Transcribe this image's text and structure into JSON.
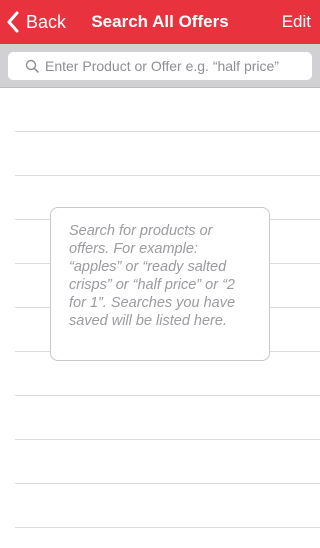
{
  "navbar": {
    "back_label": "Back",
    "title": "Search All Offers",
    "edit_label": "Edit",
    "background_color": "#e8333f"
  },
  "search": {
    "placeholder": "Enter Product or Offer e.g. “half price”",
    "value": ""
  },
  "empty_state": {
    "hint": "Search for products or offers. For example: “apples” or “ready salted crisps” or “half price” or “2 for 1”. Searches you have saved will be listed here."
  }
}
